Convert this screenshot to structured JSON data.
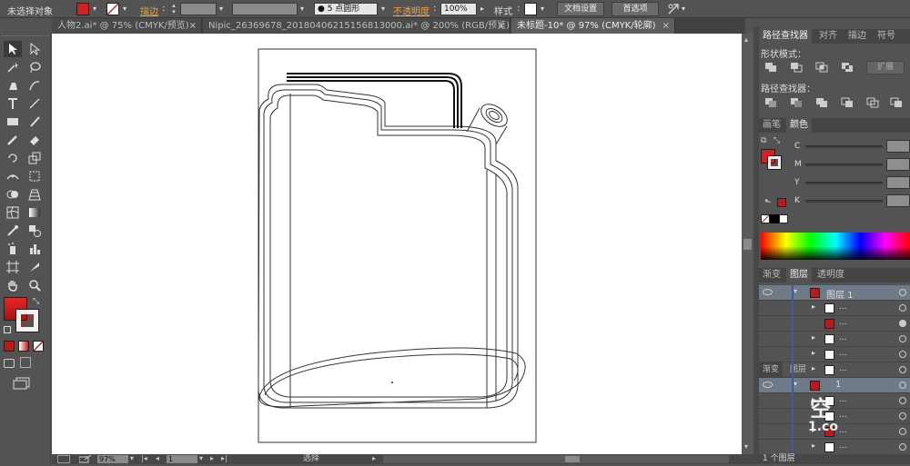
{
  "control_bar": {
    "selection_status": "未选择对象",
    "stroke_label": "描边",
    "brush_label": "5 点圆形",
    "opacity_label": "不透明度",
    "opacity_value": "100%",
    "style_label": "样式",
    "doc_setup_button": "文档设置",
    "preferences_button": "首选项",
    "fill_color": "#d42020"
  },
  "tabs": [
    {
      "label": "人物2.ai* @ 75% (CMYK/预览)",
      "close": "×"
    },
    {
      "label": "Nipic_26369678_20180406215156813000.ai* @ 200% (RGB/预览)",
      "close": "×"
    },
    {
      "label": "未标题-10* @ 97% (CMYK/轮廓)",
      "close": "×"
    }
  ],
  "status_bar": {
    "zoom": "97%",
    "page": "1",
    "tool": "选择"
  },
  "pathfinder_panel": {
    "tabs": [
      "路径查找器",
      "对齐",
      "描边",
      "符号"
    ],
    "shape_modes_label": "形状模式：",
    "expand_button": "扩展",
    "pathfinders_label": "路径查找器："
  },
  "color_panel": {
    "tabs": [
      "画笔",
      "颜色"
    ],
    "channels": [
      "C",
      "M",
      "Y",
      "K"
    ]
  },
  "layers_panel": {
    "tabs": [
      "渐变",
      "图层",
      "透明度"
    ],
    "layer_name": "图层 1",
    "second_tabs": [
      "渐变",
      "图层"
    ],
    "dup_layer_name": "1",
    "dots": "...",
    "footer": "1 个图层"
  },
  "watermark": {
    "top": "空",
    "bottom": "1.co"
  }
}
